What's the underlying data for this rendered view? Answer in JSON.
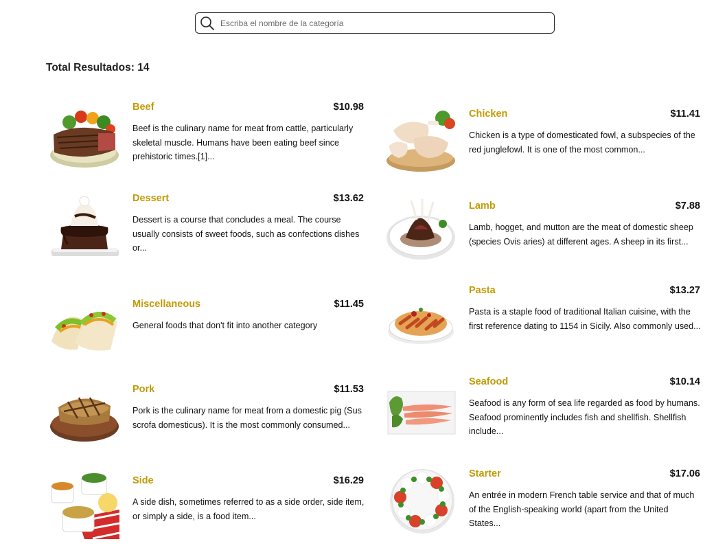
{
  "search": {
    "placeholder": "Escriba el nombre de la categoría",
    "value": ""
  },
  "total": {
    "label": "Total Resultados:",
    "count": "14"
  },
  "categories": [
    {
      "name": "Beef",
      "price": "$10.98",
      "description": "Beef is the culinary name for meat from cattle, particularly skeletal muscle. Humans have been eating beef since prehistoric times.[1]...",
      "image": "beef-steak-image"
    },
    {
      "name": "Chicken",
      "price": "$11.41",
      "description": "Chicken is a type of domesticated fowl, a subspecies of the red junglefowl. It is one of the most common...",
      "image": "chicken-legs-image"
    },
    {
      "name": "Dessert",
      "price": "$13.62",
      "description": "Dessert is a course that concludes a meal. The course usually consists of sweet foods, such as confections dishes or...",
      "image": "chocolate-cake-image"
    },
    {
      "name": "Lamb",
      "price": "$7.88",
      "description": "Lamb, hogget, and mutton are the meat of domestic sheep (species Ovis aries) at different ages.  A sheep in its first...",
      "image": "lamb-chops-image"
    },
    {
      "name": "Miscellaneous",
      "price": "$11.45",
      "description": "General foods that don't fit into another category",
      "image": "tacos-image"
    },
    {
      "name": "Pasta",
      "price": "$13.27",
      "description": "Pasta is a staple food of traditional Italian cuisine, with the first reference dating to 1154 in Sicily.  Also commonly used...",
      "image": "penne-pasta-image"
    },
    {
      "name": "Pork",
      "price": "$11.53",
      "description": "Pork is the culinary name for meat from a domestic pig (Sus scrofa domesticus). It is the most commonly consumed...",
      "image": "pork-chop-image"
    },
    {
      "name": "Seafood",
      "price": "$10.14",
      "description": "Seafood is any form of sea life regarded as food by humans. Seafood prominently includes fish and shellfish. Shellfish include...",
      "image": "salmon-plate-image"
    },
    {
      "name": "Side",
      "price": "$16.29",
      "description": "A side dish, sometimes referred to as a side order, side item, or simply a side, is a food item...",
      "image": "side-dishes-image"
    },
    {
      "name": "Starter",
      "price": "$17.06",
      "description": "An entrée in modern French table service and that of much of the English-speaking world (apart from the United States...",
      "image": "caprese-salad-image"
    }
  ],
  "colors": {
    "category_name": "#c19a06",
    "price": "#111111",
    "search_border": "#222222"
  }
}
